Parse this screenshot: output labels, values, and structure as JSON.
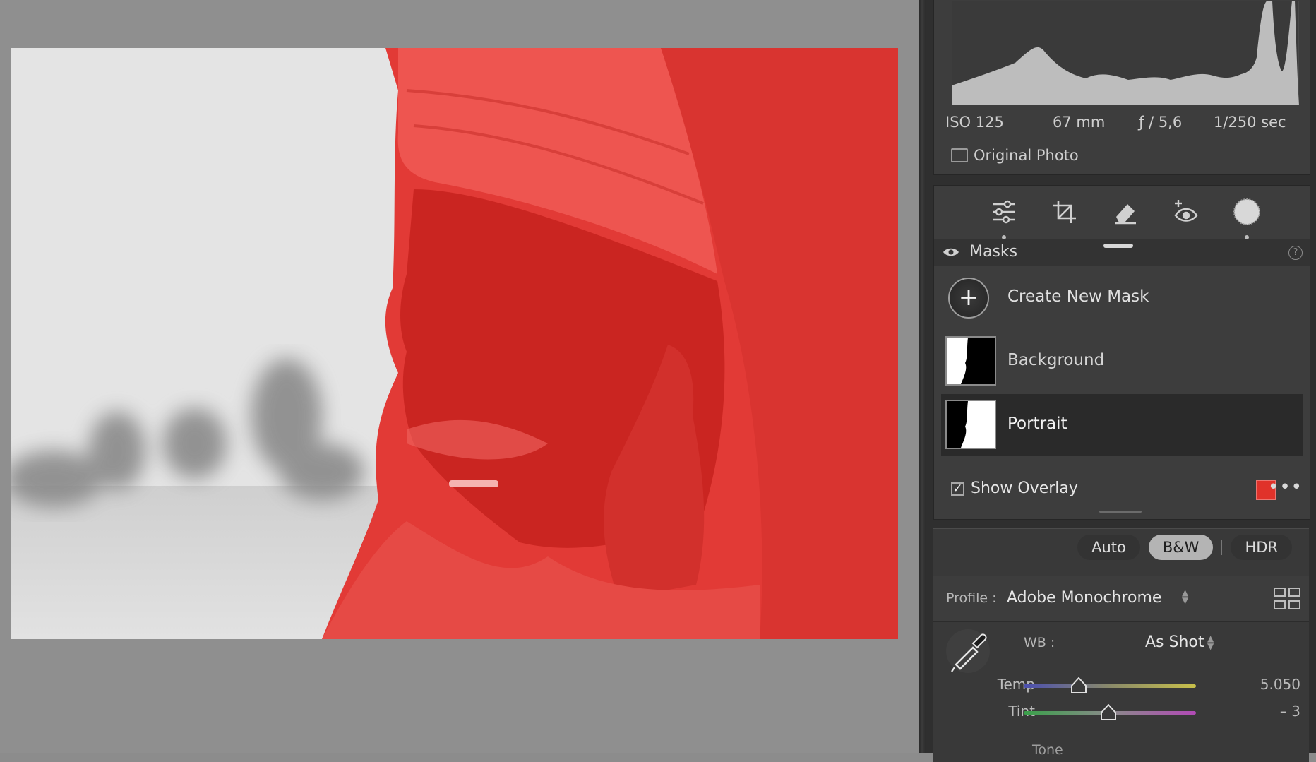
{
  "histogram": {
    "iso": "ISO 125",
    "focal_length": "67 mm",
    "aperture": "ƒ / 5,6",
    "shutter": "1/250 sec",
    "original_photo_label": "Original Photo"
  },
  "toolbar": {
    "tools": [
      "edit-icon",
      "crop-icon",
      "remove-icon",
      "redeye-icon",
      "masking-icon"
    ]
  },
  "masks": {
    "title": "Masks",
    "help": "?",
    "create_new_mask": "Create New Mask",
    "items": [
      {
        "label": "Background"
      },
      {
        "label": "Portrait"
      }
    ],
    "show_overlay_label": "Show Overlay",
    "show_overlay_checked": true,
    "overlay_color": "#e0322a",
    "more": "•••"
  },
  "basic": {
    "treatment": {
      "auto": "Auto",
      "bw": "B&W",
      "hdr": "HDR"
    },
    "profile_label": "Profile :",
    "profile_value": "Adobe Monochrome",
    "wb_label": "WB :",
    "wb_value": "As Shot",
    "temp_label": "Temp",
    "temp_value": "5.050",
    "temp_position": 0.32,
    "tint_label": "Tint",
    "tint_value": "– 3",
    "tint_position": 0.49,
    "tone_label": "Tone"
  },
  "colors": {
    "overlay_red": "#e0322a",
    "panel_bg": "#3d3d3d"
  }
}
